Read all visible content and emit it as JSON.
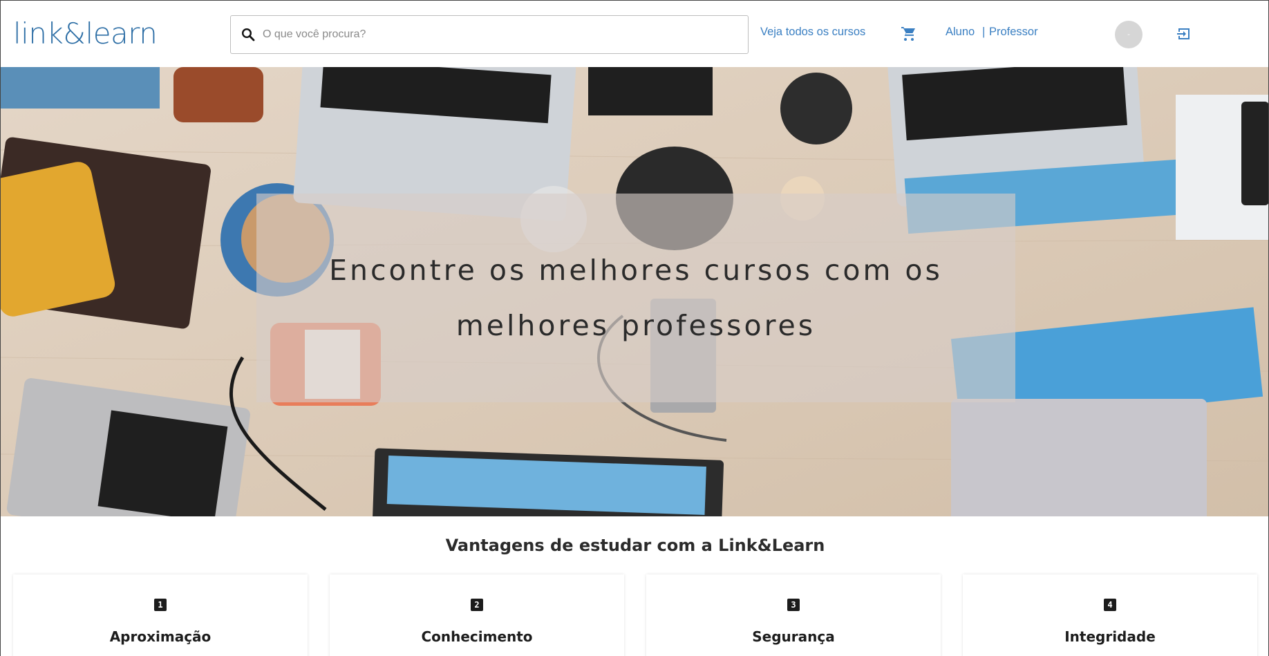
{
  "header": {
    "logo_text": "link&learn",
    "search": {
      "placeholder": "O que você procura?"
    },
    "nav": {
      "all_courses": "Veja todos os cursos",
      "aluno": "Aluno",
      "separator": "|",
      "professor": "Professor"
    },
    "avatar_text": "-"
  },
  "hero": {
    "title": "Encontre os melhores cursos com os melhores professores"
  },
  "advantages": {
    "title": "Vantagens de estudar com a Link&Learn",
    "items": [
      {
        "number": "1",
        "label": "Aproximação"
      },
      {
        "number": "2",
        "label": "Conhecimento"
      },
      {
        "number": "3",
        "label": "Segurança"
      },
      {
        "number": "4",
        "label": "Integridade"
      }
    ]
  },
  "colors": {
    "brand": "#2e6fa6",
    "link": "#3a7fc2",
    "text": "#2b2b2b"
  },
  "icons": [
    "search-icon",
    "cart-icon",
    "logout-icon"
  ]
}
